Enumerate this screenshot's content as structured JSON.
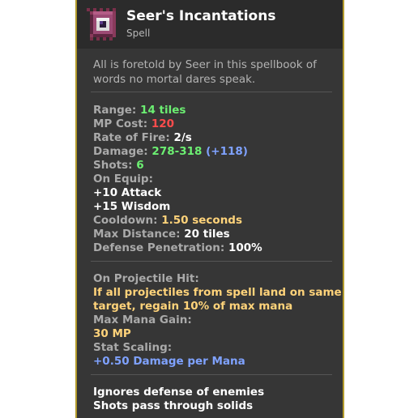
{
  "item": {
    "name": "Seer's Incantations",
    "type": "Spell",
    "description": "All is foretold by Seer in this spellbook of words no mortal dares speak."
  },
  "stats": {
    "range_label": "Range:",
    "range_value": "14 tiles",
    "mp_cost_label": "MP Cost:",
    "mp_cost_value": "120",
    "rate_of_fire_label": "Rate of Fire:",
    "rate_of_fire_value": "2/s",
    "damage_label": "Damage:",
    "damage_value": "278-318",
    "damage_bonus": "(+118)",
    "shots_label": "Shots:",
    "shots_value": "6",
    "on_equip_label": "On Equip:",
    "on_equip": [
      "+10 Attack",
      "+15 Wisdom"
    ],
    "cooldown_label": "Cooldown:",
    "cooldown_value": "1.50 seconds",
    "max_distance_label": "Max Distance:",
    "max_distance_value": "20 tiles",
    "defense_pen_label": "Defense Penetration:",
    "defense_pen_value": "100%"
  },
  "projectile": {
    "on_hit_label": "On Projectile Hit:",
    "on_hit_text_1": "If all projectiles from spell land on same",
    "on_hit_text_2": "target, regain 10% of max mana",
    "max_mana_gain_label": "Max Mana Gain:",
    "max_mana_gain_value": "30 MP",
    "stat_scaling_label": "Stat Scaling:",
    "stat_scaling_value": "+0.50 Damage per Mana"
  },
  "properties": [
    "Ignores defense of enemies",
    "Shots pass through solids"
  ],
  "colors": {
    "border": "#b39b2c",
    "panel": "#363636",
    "header": "#2b2b2b",
    "green": "#6cef72",
    "red": "#ff4c4c",
    "blue": "#7fa2ff",
    "gold": "#ffd37a"
  }
}
